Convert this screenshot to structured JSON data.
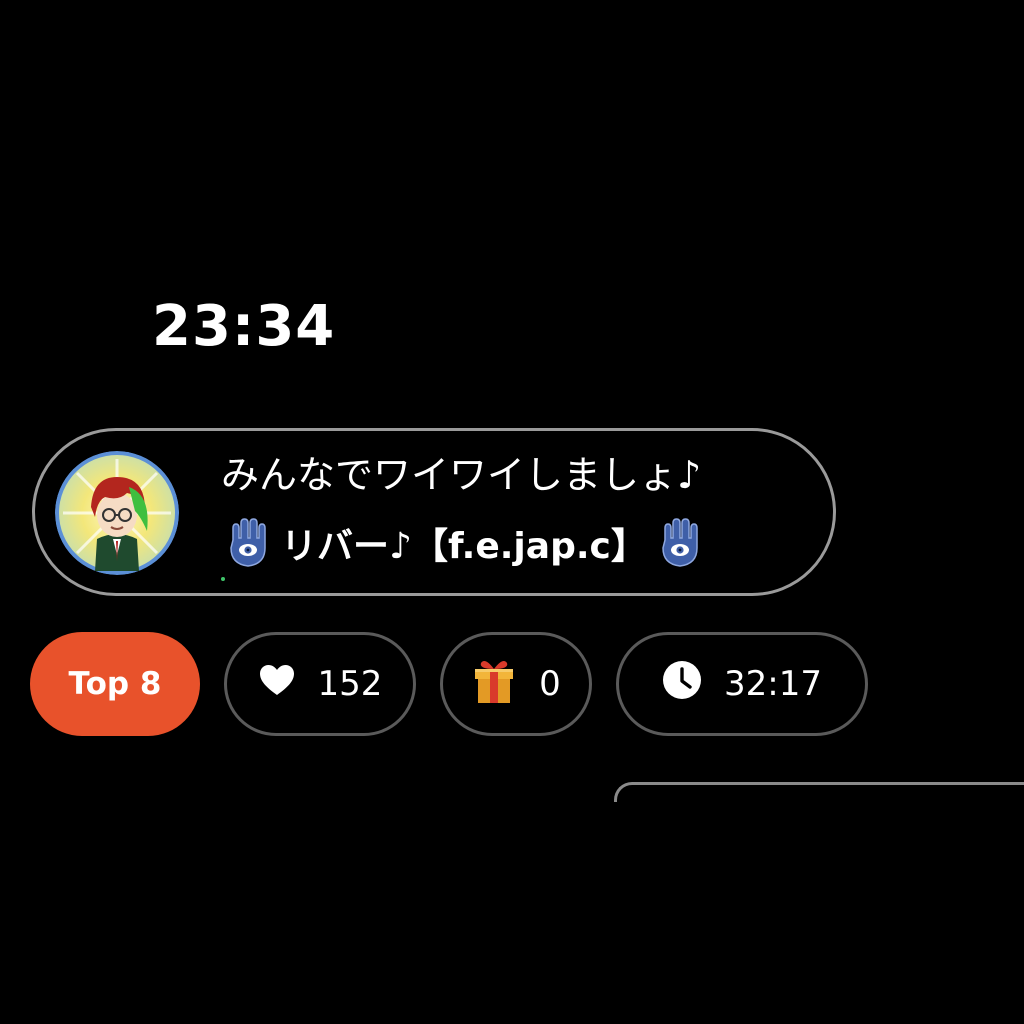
{
  "status": {
    "clock": "23:34"
  },
  "room": {
    "title": "みんなでワイワイしましょ♪",
    "host_name": "リバー♪【f.e.jap.c】",
    "left_icon": "hamsa-hand-icon",
    "right_icon": "hamsa-hand-icon",
    "avatar": "host-avatar"
  },
  "stats": {
    "rank_label": "Top 8",
    "likes": "152",
    "gifts": "0",
    "duration": "32:17"
  },
  "colors": {
    "rank_badge": "#e8522b",
    "card_border": "#9a9a9a",
    "pill_border": "#5a5a5a",
    "hamsa": "#3f5fa8"
  }
}
